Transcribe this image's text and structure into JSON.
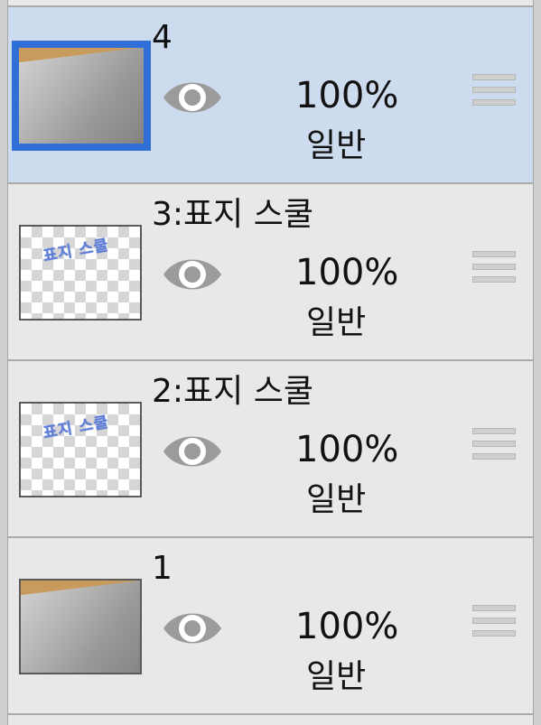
{
  "layers": [
    {
      "name": "4",
      "opacity": "100%",
      "blend": "일반",
      "selected": true,
      "thumb": "paper"
    },
    {
      "name": "3:표지 스쿨",
      "opacity": "100%",
      "blend": "일반",
      "selected": false,
      "thumb": "text",
      "thumb_text": "표지 스쿨"
    },
    {
      "name": "2:표지 스쿨",
      "opacity": "100%",
      "blend": "일반",
      "selected": false,
      "thumb": "text",
      "thumb_text": "표지 스쿨"
    },
    {
      "name": "1",
      "opacity": "100%",
      "blend": "일반",
      "selected": false,
      "thumb": "paper"
    }
  ],
  "icons": {
    "visibility": "eye-icon",
    "drag": "drag-handle-icon"
  },
  "colors": {
    "selected_row": "#cddbee",
    "selected_border": "#2f6fd6",
    "row_bg": "#e8e8e8"
  }
}
